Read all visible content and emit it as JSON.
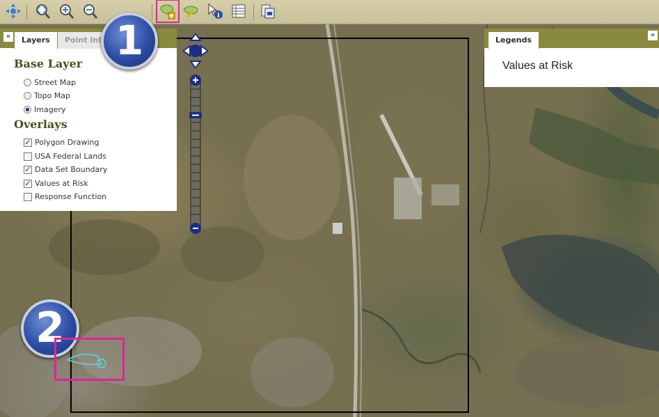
{
  "toolbar": {
    "tools": [
      {
        "icon": "pan-icon"
      },
      {
        "icon": "zoom-extent-icon"
      },
      {
        "icon": "zoom-in-icon"
      },
      {
        "icon": "zoom-out-icon"
      },
      {
        "icon": "draw-polygon-icon",
        "active": true
      },
      {
        "icon": "polygon-edit-icon"
      },
      {
        "icon": "identify-icon"
      },
      {
        "icon": "table-icon"
      },
      {
        "icon": "print-icon"
      }
    ]
  },
  "left_panel": {
    "tabs": [
      {
        "label": "Layers",
        "active": true
      },
      {
        "label": "Point Inf",
        "active": false
      }
    ],
    "base_layer": {
      "title": "Base Layer",
      "options": [
        {
          "label": "Street Map",
          "selected": false
        },
        {
          "label": "Topo Map",
          "selected": false
        },
        {
          "label": "Imagery",
          "selected": true
        }
      ]
    },
    "overlays": {
      "title": "Overlays",
      "options": [
        {
          "label": "Polygon Drawing",
          "checked": true
        },
        {
          "label": "USA Federal Lands",
          "checked": false
        },
        {
          "label": "Data Set Boundary",
          "checked": true
        },
        {
          "label": "Values at Risk",
          "checked": true
        },
        {
          "label": "Response Function",
          "checked": false
        }
      ]
    }
  },
  "right_panel": {
    "tab": "Legends",
    "content": "Values at Risk"
  },
  "badges": [
    "1",
    "2"
  ],
  "colors": {
    "highlight": "#e0239b",
    "panel_header": "#8a8a3e",
    "section_title": "#4d4d24",
    "drawn_polygon": "#5fc8d6"
  }
}
